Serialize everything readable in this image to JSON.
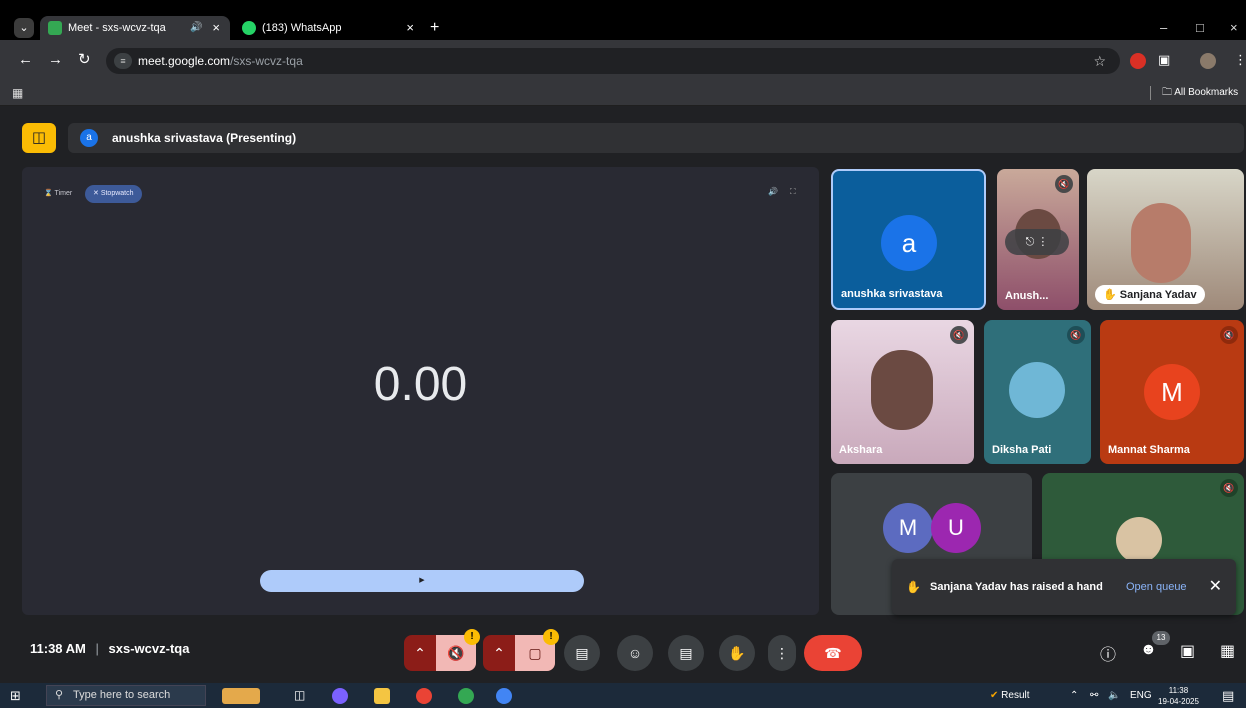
{
  "browser": {
    "tabs": [
      {
        "title": "Meet - sxs-wcvz-tqa",
        "active": true,
        "audio_icon": "speaker-icon"
      },
      {
        "title": "(183) WhatsApp",
        "active": false
      }
    ],
    "new_tab": "+",
    "address": {
      "host": "meet.google.com",
      "path": "/sxs-wcvz-tqa"
    },
    "bookmarks_label": "All Bookmarks"
  },
  "meet": {
    "presenter": {
      "initial": "a",
      "label": "anushka srivastava (Presenting)"
    },
    "stage": {
      "timer_label": "Timer",
      "stopwatch_label": "Stopwatch",
      "clock": "0.00"
    },
    "participants": [
      {
        "name": "anushka srivastava",
        "initial": "a",
        "color": "#1a73e8"
      },
      {
        "name": "Anush..."
      },
      {
        "name": "Sanjana Yadav",
        "hand_raised": true
      },
      {
        "name": "Akshara"
      },
      {
        "name": "Diksha Pati"
      },
      {
        "name": "Mannat Sharma",
        "initial": "M",
        "color": "#e8431e"
      }
    ],
    "more_avatars": [
      "M",
      "U"
    ],
    "toast": {
      "message": "Sanjana Yadav has raised a hand",
      "action": "Open queue"
    },
    "bottom": {
      "time": "11:38 AM",
      "separator": "|",
      "code": "sxs-wcvz-tqa",
      "people_count": "13",
      "mic_warning": "!",
      "cam_warning": "!"
    }
  },
  "taskbar": {
    "search_placeholder": "Type here to search",
    "tray_result": "Result",
    "tray_lang": "ENG",
    "time": "11:38",
    "date": "19-04-2025"
  },
  "colors": {
    "accent_yellow": "#fbbc04",
    "end_call_red": "#ea4335",
    "muted_red": "#8c1d18",
    "link_blue": "#8ab4f8"
  }
}
